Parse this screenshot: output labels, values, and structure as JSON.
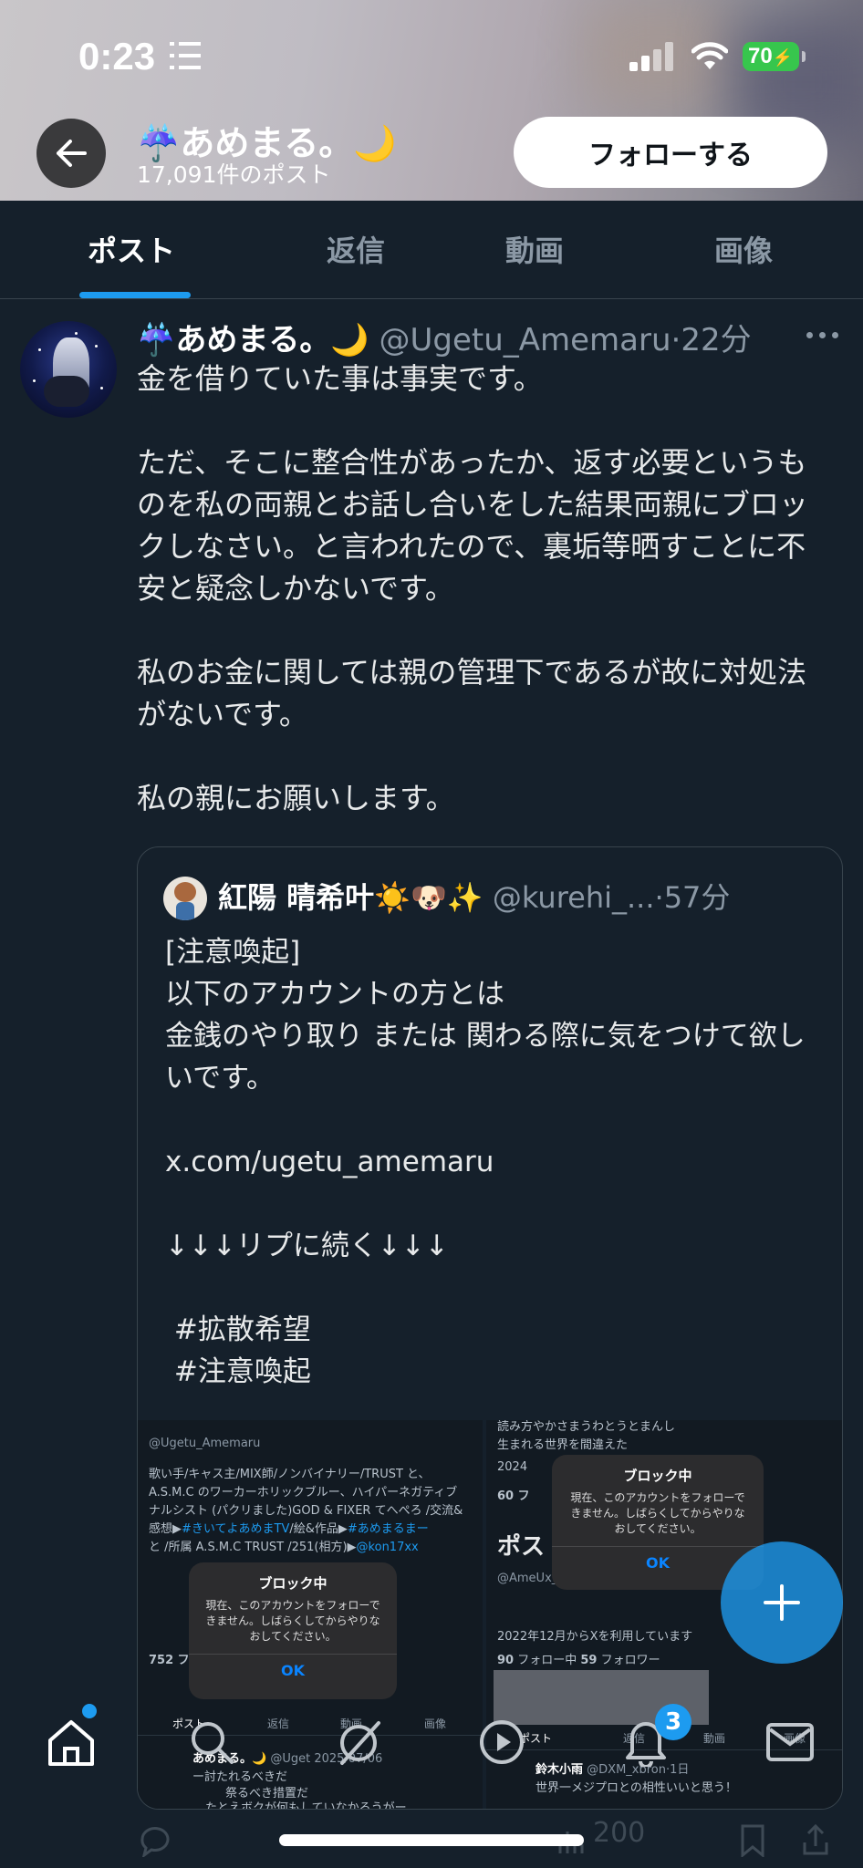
{
  "status_bar": {
    "time": "0:23",
    "battery": "70"
  },
  "profile": {
    "name": "☔️あめまる。🌙",
    "post_count": "17,091件のポスト",
    "follow_label": "フォローする"
  },
  "tabs": [
    {
      "label": "ポスト",
      "active": true
    },
    {
      "label": "返信",
      "active": false
    },
    {
      "label": "動画",
      "active": false
    },
    {
      "label": "画像",
      "active": false
    }
  ],
  "post": {
    "author_name": "☔️あめまる。🌙",
    "handle": "@Ugetu_Amemaru",
    "time": "·22分",
    "text": "金を借りていた事は事実です。\n\nただ、そこに整合性があったか、返す必要というものを私の両親とお話し合いをした結果両親にブロックしなさい。と言われたので、裏垢等晒すことに不安と疑念しかないです。\n\n私のお金に関しては親の管理下であるが故に対処法がないです。\n\n私の親にお願いします。"
  },
  "quote": {
    "author_name": "紅陽 晴希叶☀️🐶✨",
    "handle": "@kurehi_...",
    "time": "·57分",
    "text": "[注意喚起]\n以下のアカウントの方とは\n金銭のやり取り または 関わる際に気をつけて欲しいです。\n\nx.com/ugetu_amemaru\n\n↓↓↓リプに続く↓↓↓\n\n #拡散希望\n #注意喚起",
    "screenshot_left": {
      "handle": "@Ugetu_Amemaru",
      "bio_1": "歌い手/キャス主/MIX師/ノンバイナリー/TRUST と、",
      "bio_2": "A.S.M.C のワーカーホリックブルー、ハイパーネガティブ",
      "bio_3": "ナルシスト (パクリました)GOD & FIXER てへぺろ /交流&",
      "bio_4": "感想▶",
      "bio_4_link": "#きいてよあめまTV",
      "bio_4b": "/絵&作品▶",
      "bio_4c": "#あめまるまー",
      "bio_5": "と /所属 A.S.M.C TRUST /251(相方)▶",
      "bio_5_link": "@kon17xx",
      "follow_count": "752 フォ",
      "tab_post": "ポスト",
      "tab_reply": "返信",
      "tab_video": "動画",
      "tab_image": "画像",
      "post_name": "あめまる。🌙",
      "post_handle": "@Uget",
      "post_date": "2025/07/06",
      "post_line1": "ー討たれるべきだ",
      "post_line2": "祭るべき措置だ",
      "post_line3": "たとえボクが何もしていなかろうがー",
      "dialog_title": "ブロック中",
      "dialog_message": "現在、このアカウントをフォローできません。しばらくしてからやりなおしてください。",
      "dialog_ok": "OK"
    },
    "screenshot_right": {
      "top_line": "読み方やかさまうわとうとまんし",
      "born": "生まれる世界を間違えた",
      "year": "2024",
      "sixty": "60 フ",
      "posts_heading": "ポス",
      "approved": "@AmeUx_xU_sab さんから承認された場合",
      "joined": "2022年12月からXを利用しています",
      "following": "90",
      "following_label": "フォロー中",
      "followers": "59",
      "followers_label": "フォロワー",
      "tab_post": "ポスト",
      "tab_reply": "返信",
      "tab_video": "動画",
      "tab_image": "画像",
      "post_name": "鈴木小雨",
      "post_handle": "@DXM_xbron",
      "post_time": "·1日",
      "post_text": "世界一メジプロとの相性いいと思う！",
      "dialog_title": "ブロック中",
      "dialog_message": "現在、このアカウントをフォローできません。しばらくしてからやりなおしてください。",
      "dialog_ok": "OK"
    }
  },
  "post_actions": {
    "views": "200"
  },
  "bottom_nav": {
    "notification_count": "3"
  },
  "colors": {
    "background": "#15202b",
    "accent": "#1d9bf0",
    "muted": "#8b98a5"
  }
}
